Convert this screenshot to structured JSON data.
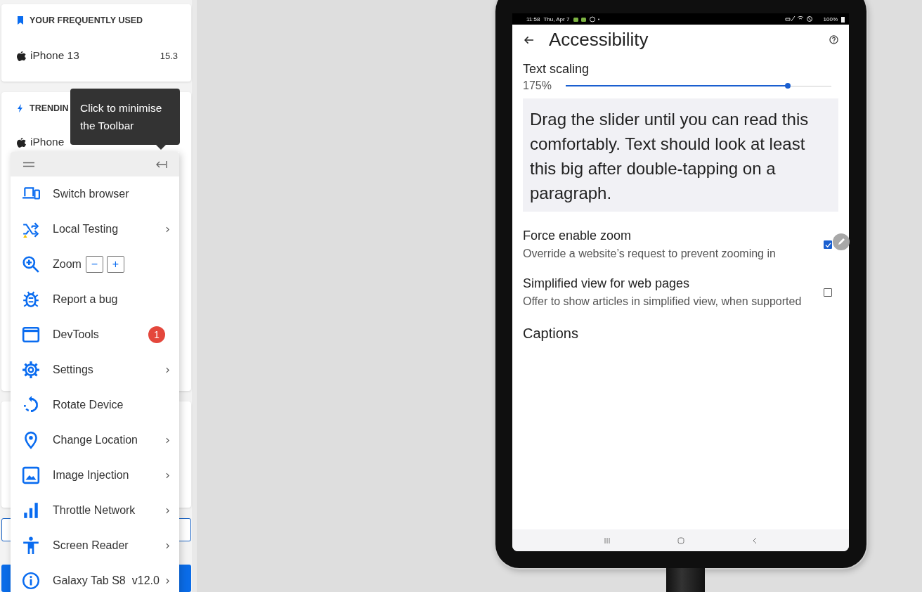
{
  "sidebar": {
    "cards": [
      {
        "kind": "frequent",
        "title": "YOUR FREQUENTLY USED",
        "devices": [
          {
            "name": "iPhone 13",
            "version": "15.3"
          }
        ]
      },
      {
        "kind": "trending",
        "title": "TRENDIN",
        "devices": [
          {
            "name": "iPhone"
          }
        ]
      }
    ]
  },
  "tooltip": {
    "text": "Click to minimise the Toolbar"
  },
  "toolbar": {
    "items": [
      {
        "kind": "plain",
        "label": "Switch browser",
        "submenu": false
      },
      {
        "kind": "plain",
        "label": "Local Testing",
        "submenu": true
      },
      {
        "kind": "zoom",
        "label": "Zoom",
        "buttons": [
          "−",
          "+"
        ],
        "submenu": false
      },
      {
        "kind": "plain",
        "label": "Report a bug",
        "submenu": false
      },
      {
        "kind": "badge",
        "label": "DevTools",
        "badge": "1",
        "submenu": false
      },
      {
        "kind": "plain",
        "label": "Settings",
        "submenu": true
      },
      {
        "kind": "plain",
        "label": "Rotate Device",
        "submenu": false
      },
      {
        "kind": "plain",
        "label": "Change Location",
        "submenu": true
      },
      {
        "kind": "plain",
        "label": "Image Injection",
        "submenu": true
      },
      {
        "kind": "plain",
        "label": "Throttle Network",
        "submenu": true
      },
      {
        "kind": "plain",
        "label": "Screen Reader",
        "submenu": true
      },
      {
        "kind": "device",
        "label": "Galaxy Tab S8",
        "version": "v12.0",
        "submenu": true
      }
    ]
  },
  "device": {
    "status_bar": {
      "time": "11:58",
      "date": "Thu, Apr 7",
      "battery": "100%"
    },
    "title": "Accessibility",
    "text_scaling": {
      "label": "Text scaling",
      "reading": "175%",
      "level": 0.835
    },
    "preview": "Drag the slider until you can read this comfortably. Text should look at least this big after double-tapping on a paragraph.",
    "settings": [
      {
        "title": "Force enable zoom",
        "subtitle": "Override a website’s request to prevent zooming in",
        "checked": true
      },
      {
        "title": "Simplified view for web pages",
        "subtitle": "Offer to show articles in simplified view, when supported",
        "checked": false
      }
    ],
    "section": "Captions"
  }
}
